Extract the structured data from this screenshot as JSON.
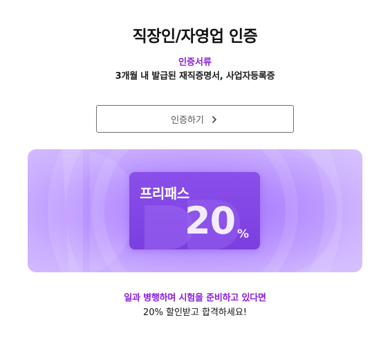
{
  "page": {
    "title": "직장인/자영업 인증",
    "documents_label": "인증서류",
    "documents_value": "3개월 내 발급된 재직증명서, 사업자등록증",
    "verify_button_label": "인증하기",
    "verify_button_icon": "chevron-right-icon"
  },
  "banner": {
    "pass_name": "프리패스",
    "discount_value": "20",
    "discount_unit": "%",
    "colors": {
      "background": "#b58dff",
      "card": "#8a4eea"
    }
  },
  "promo": {
    "line1": "일과 병행하며 시험을 준비하고 있다면",
    "line2": "20% 할인받고 합격하세요!"
  },
  "colors": {
    "accent": "#8a1be0",
    "text": "#111111",
    "button_border": "#6e6e6e"
  }
}
